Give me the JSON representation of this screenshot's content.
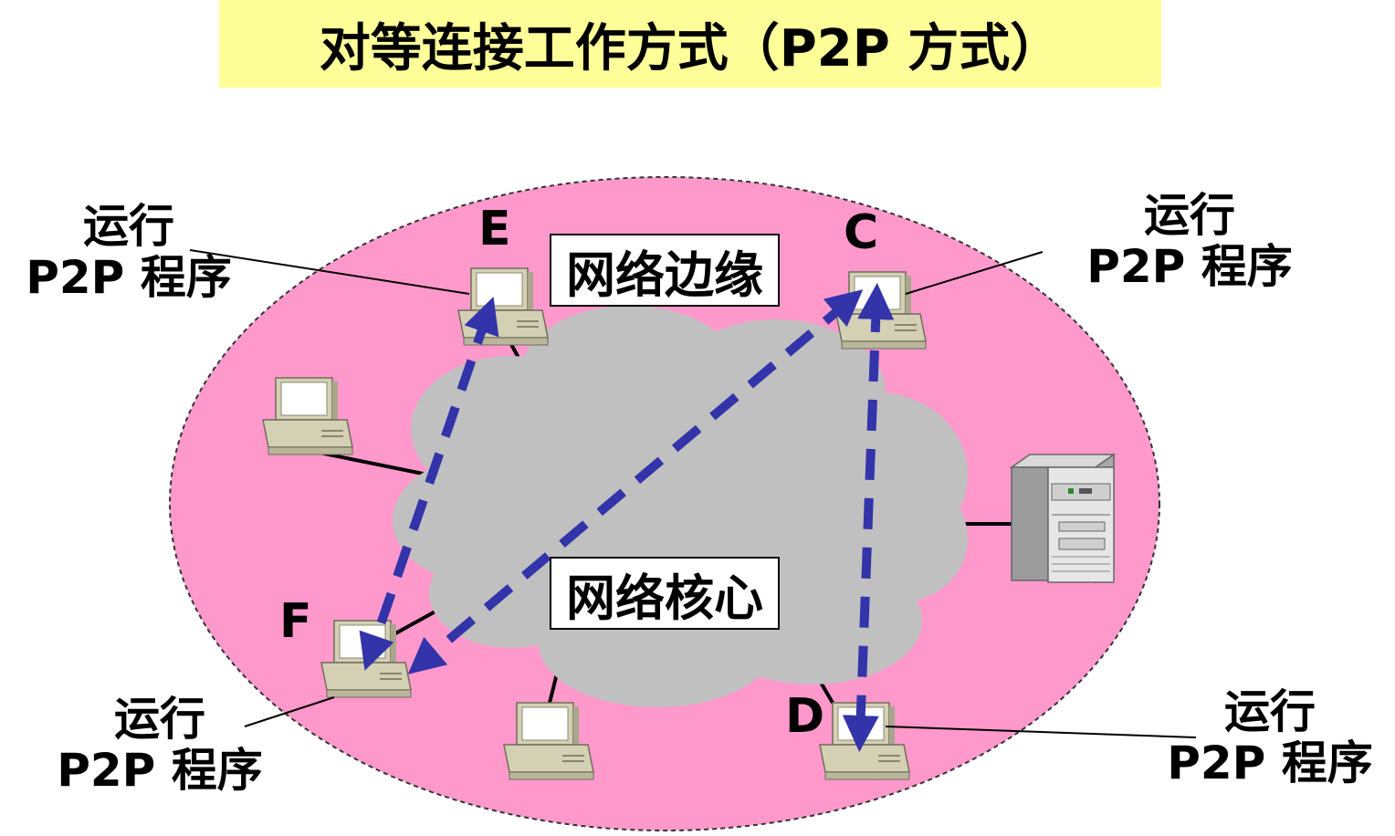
{
  "title": "对等连接工作方式（P2P 方式）",
  "regions": {
    "edge": "网络边缘",
    "core": "网络核心"
  },
  "nodes": {
    "E": "E",
    "C": "C",
    "D": "D",
    "F": "F"
  },
  "program_label": {
    "line1": "运行",
    "line2": "P2P 程序"
  },
  "colors": {
    "title_bg": "#ffff99",
    "edge_fill": "#ff99cc",
    "core_fill": "#c0c0c0",
    "arrow": "#3333aa"
  }
}
